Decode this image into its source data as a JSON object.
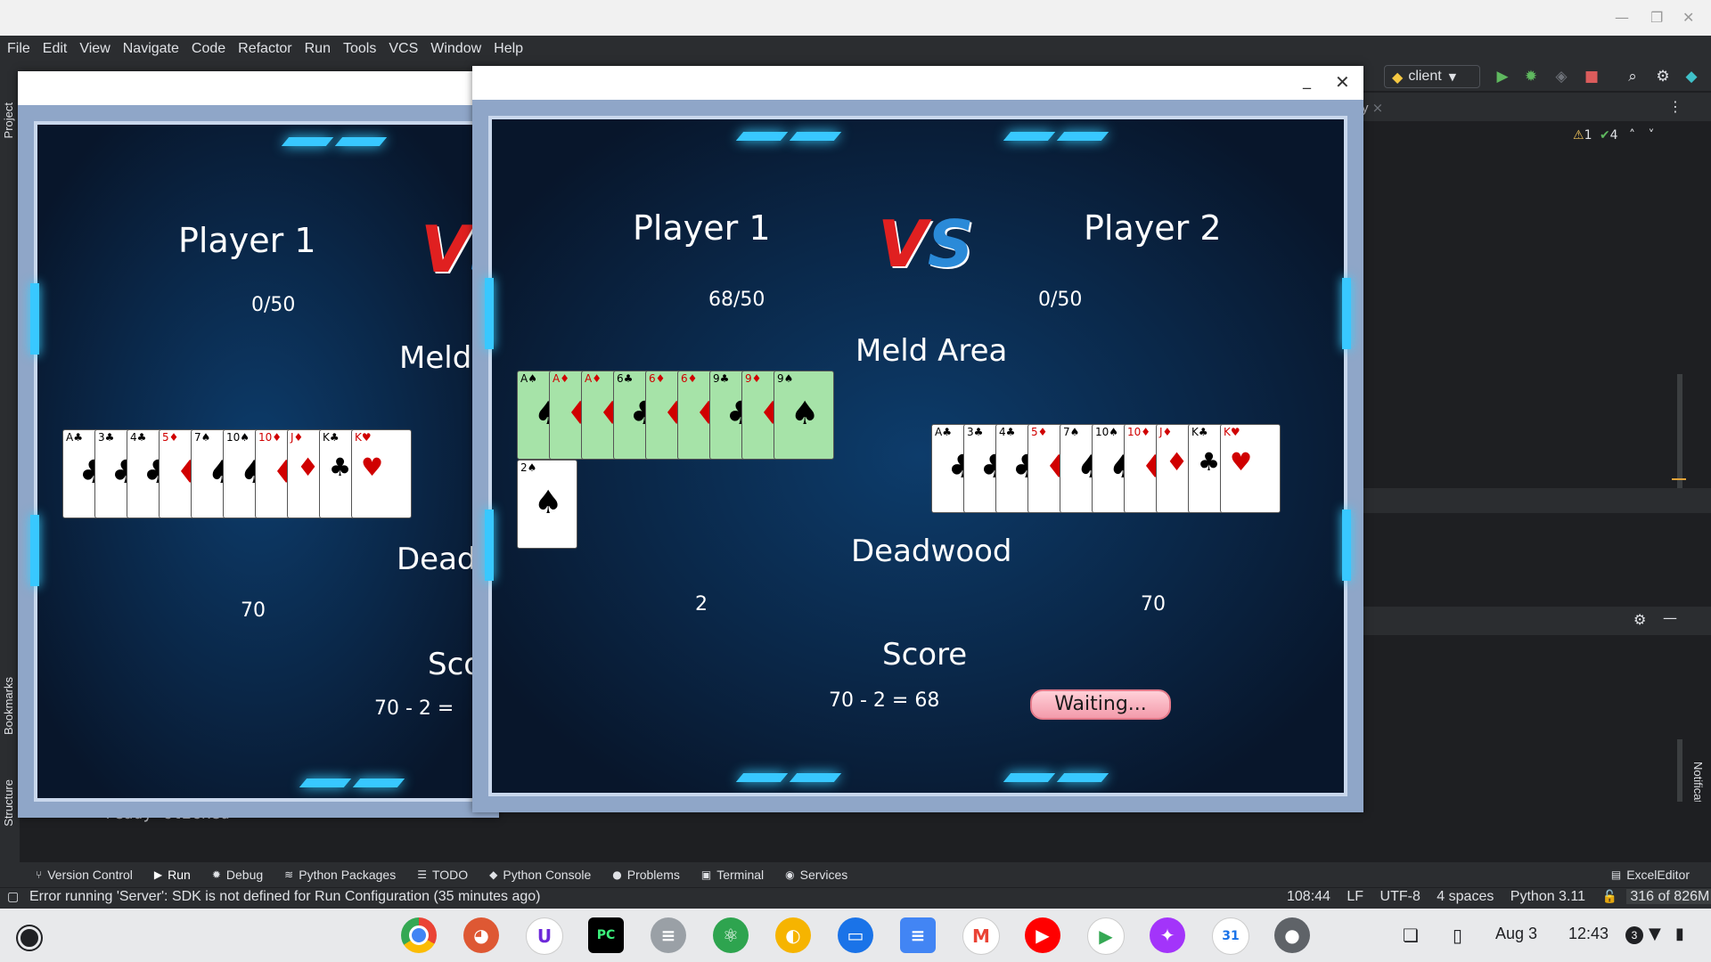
{
  "ide": {
    "menu": [
      "File",
      "Edit",
      "View",
      "Navigate",
      "Code",
      "Refactor",
      "Run",
      "Tools",
      "VCS",
      "Window",
      "Help"
    ],
    "run_config": "client",
    "inspections": {
      "warnings": "1",
      "ok": "4"
    },
    "side_tabs": {
      "project": "Project",
      "bookmarks": "Bookmarks",
      "structure": "Structure",
      "notifications": "Notifications"
    },
    "console_text": "ready clicked",
    "tool_windows": [
      "Version Control",
      "Run",
      "Debug",
      "Python Packages",
      "TODO",
      "Python Console",
      "Problems",
      "Terminal",
      "Services"
    ],
    "excel_editor": "ExcelEditor",
    "status": {
      "message": "Error running 'Server': SDK is not defined for Run Configuration (35 minutes ago)",
      "position": "108:44",
      "line_sep": "LF",
      "encoding": "UTF-8",
      "indent": "4 spaces",
      "interpreter": "Python 3.11",
      "memory": "316 of 826M"
    }
  },
  "game_back": {
    "player1": "Player 1",
    "p1_progress": "0/50",
    "meld_partial": "Meld A",
    "deadwood_partial": "Deadw",
    "deadwood_value": "70",
    "score_partial": "Sco",
    "score_formula": "70 - 2 ="
  },
  "game_front": {
    "player1": "Player 1",
    "player2": "Player 2",
    "p1_progress": "68/50",
    "p2_progress": "0/50",
    "meld_area": "Meld Area",
    "deadwood": "Deadwood",
    "p1_deadwood": "2",
    "p2_deadwood": "70",
    "score": "Score",
    "score_formula": "70 - 2 = 68",
    "waiting_button": "Waiting..."
  },
  "hand_cards": [
    "A♣",
    "3♣",
    "4♣",
    "5♦",
    "7♠",
    "10♠",
    "10♦",
    "J♦",
    "K♣",
    "K♥"
  ],
  "meld_cards": [
    "A♠",
    "A♦",
    "A♦",
    "6♣",
    "6♦",
    "6♦",
    "9♣",
    "9♦",
    "9♠"
  ],
  "loose_card": "2♠",
  "taskbar": {
    "date": "Aug 3",
    "time": "12:43",
    "badge": "3"
  }
}
